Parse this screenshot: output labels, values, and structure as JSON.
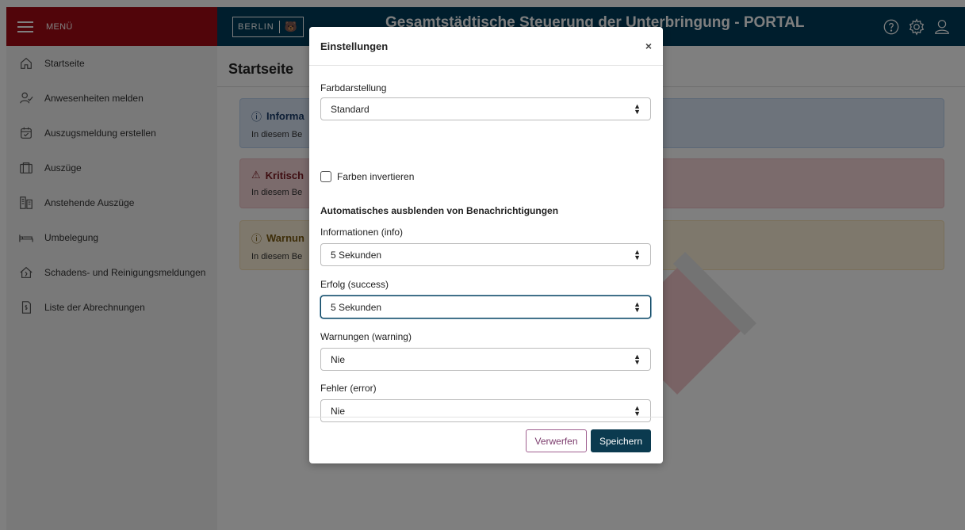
{
  "menu": {
    "label": "MENÜ"
  },
  "sidebar": {
    "items": [
      {
        "label": "Startseite",
        "icon": "home-icon"
      },
      {
        "label": "Anwesenheiten melden",
        "icon": "user-check-icon"
      },
      {
        "label": "Auszugsmeldung erstellen",
        "icon": "calendar-check-icon"
      },
      {
        "label": "Auszüge",
        "icon": "folder-icon"
      },
      {
        "label": "Anstehende Auszüge",
        "icon": "building-icon"
      },
      {
        "label": "Umbelegung",
        "icon": "bed-icon"
      },
      {
        "label": "Schadens- und Reinigungsmeldungen",
        "icon": "damaged-home-icon"
      },
      {
        "label": "Liste der Abrechnungen",
        "icon": "invoice-icon"
      }
    ]
  },
  "header": {
    "logo_text": "BERLIN",
    "logo_bear": "🐻",
    "title": "Gesamtstädtische Steuerung der Unterbringung - PORTAL"
  },
  "main": {
    "title": "Startseite",
    "alerts": [
      {
        "title": "Informa",
        "text": "In diesem Be",
        "icon": "info-icon"
      },
      {
        "title": "Kritisch",
        "text": "In diesem Be",
        "icon": "warning-triangle-icon"
      },
      {
        "title": "Warnun",
        "text": "In diesem Be",
        "icon": "alert-circle-icon"
      }
    ]
  },
  "modal": {
    "title": "Einstellungen",
    "close": "×",
    "color_label": "Farbdarstellung",
    "color_value": "Standard",
    "invert_label": "Farben invertieren",
    "section_heading": "Automatisches ausblenden von Benachrichtigungen",
    "info_label": "Informationen (info)",
    "info_value": "5 Sekunden",
    "success_label": "Erfolg (success)",
    "success_value": "5 Sekunden",
    "warning_label": "Warnungen (warning)",
    "warning_value": "Nie",
    "error_label": "Fehler (error)",
    "error_value": "Nie",
    "discard_label": "Verwerfen",
    "save_label": "Speichern"
  },
  "colors": {
    "menu_red": "#a30b14",
    "header_blue": "#003c5a",
    "save_button": "#0b3a4f"
  }
}
